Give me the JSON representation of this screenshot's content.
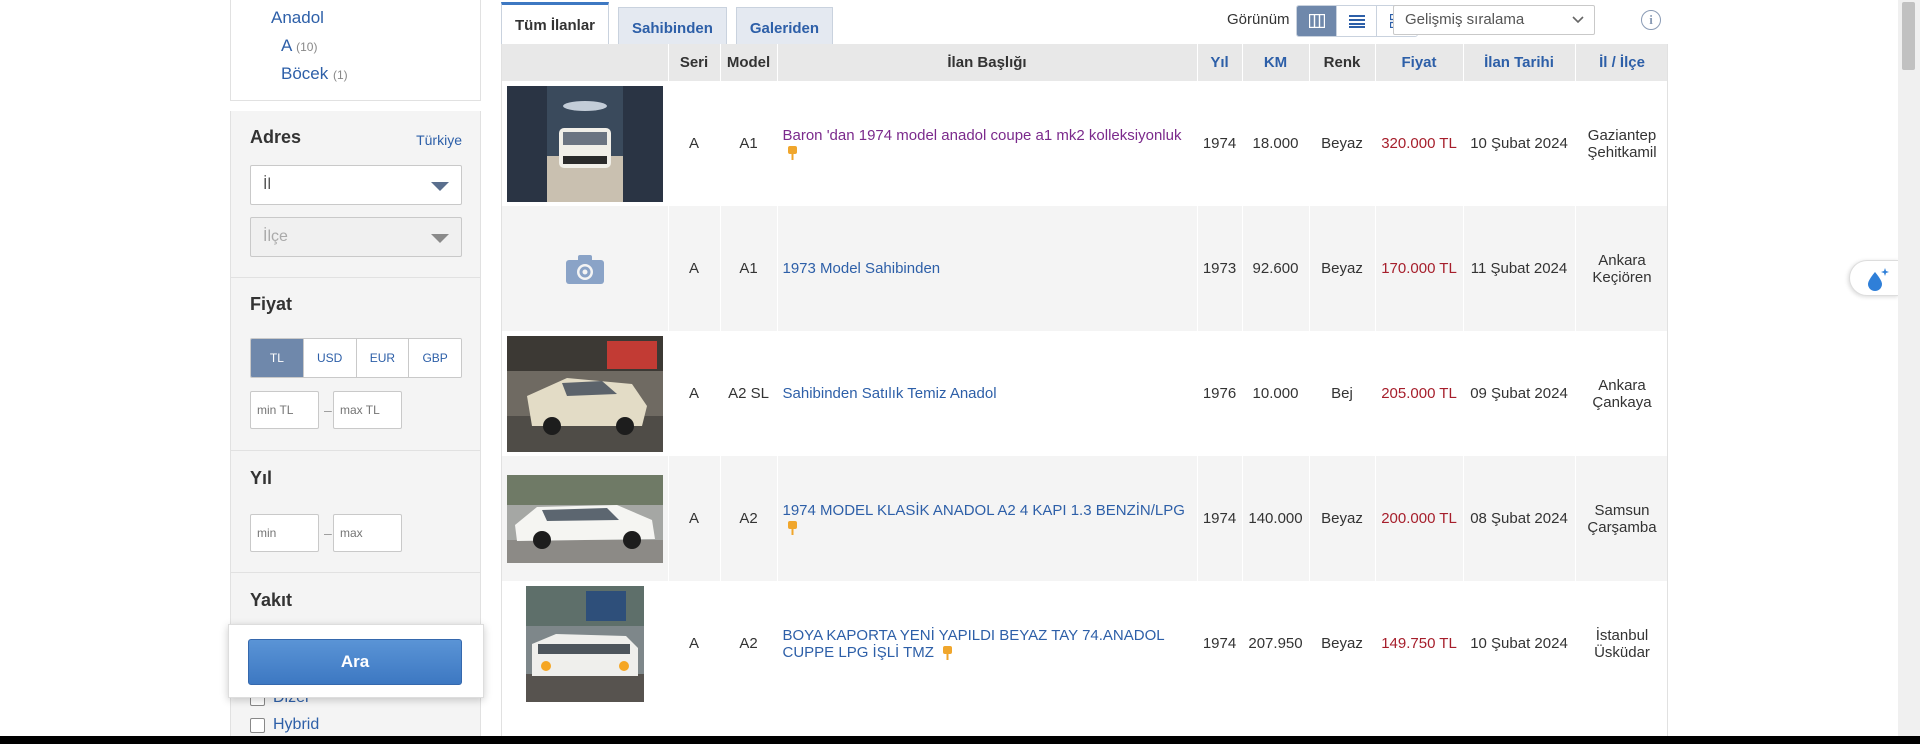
{
  "sidebar": {
    "categories": [
      {
        "label": "Anadol",
        "count": ""
      },
      {
        "label": "A",
        "count": "(10)"
      },
      {
        "label": "Böcek",
        "count": "(1)"
      }
    ],
    "address": {
      "title": "Adres",
      "country_link": "Türkiye",
      "city_placeholder": "İl",
      "district_placeholder": "İlçe"
    },
    "price": {
      "title": "Fiyat",
      "currencies": [
        "TL",
        "USD",
        "EUR",
        "GBP"
      ],
      "selected_currency": "TL",
      "min_placeholder": "min TL",
      "max_placeholder": "max TL",
      "separator": "–"
    },
    "year": {
      "title": "Yıl",
      "min_placeholder": "min",
      "max_placeholder": "max",
      "separator": "–"
    },
    "fuel": {
      "title": "Yakıt",
      "options": [
        "Dizel",
        "Hybrid"
      ]
    },
    "search_button": "Ara"
  },
  "tabs": [
    {
      "label": "Tüm İlanlar",
      "active": true
    },
    {
      "label": "Sahibinden",
      "active": false
    },
    {
      "label": "Galeriden",
      "active": false
    }
  ],
  "toolbar": {
    "view_label": "Görünüm",
    "view_modes": [
      "table-view-icon",
      "list-view-icon",
      "grid-view-icon"
    ],
    "active_view": "table-view-icon",
    "sort_value": "Gelişmiş sıralama",
    "info_label": "i"
  },
  "table": {
    "headers": [
      "",
      "Seri",
      "Model",
      "İlan Başlığı",
      "Yıl",
      "KM",
      "Renk",
      "Fiyat",
      "İlan Tarihi",
      "İl / İlçe"
    ],
    "rows": [
      {
        "series": "A",
        "model": "A1",
        "title": "Baron 'dan 1974 model anadol coupe a1 mk2 kolleksiyonluk",
        "year": "1974",
        "km": "18.000",
        "color": "Beyaz",
        "price": "320.000 TL",
        "date": "10 Şubat 2024",
        "city": "Gaziantep",
        "district": "Şehitkamil",
        "has_pin": true,
        "visited": true,
        "photo": "car-white-showroom"
      },
      {
        "series": "A",
        "model": "A1",
        "title": "1973 Model Sahibinden",
        "year": "1973",
        "km": "92.600",
        "color": "Beyaz",
        "price": "170.000 TL",
        "date": "11 Şubat 2024",
        "city": "Ankara",
        "district": "Keçiören",
        "has_pin": false,
        "visited": false,
        "photo": "no-photo"
      },
      {
        "series": "A",
        "model": "A2 SL",
        "title": "Sahibinden Satılık Temiz Anadol",
        "year": "1976",
        "km": "10.000",
        "color": "Bej",
        "price": "205.000 TL",
        "date": "09 Şubat 2024",
        "city": "Ankara",
        "district": "Çankaya",
        "has_pin": false,
        "visited": false,
        "photo": "car-beige-street"
      },
      {
        "series": "A",
        "model": "A2",
        "title": "1974 MODEL KLASİK ANADOL A2 4 KAPI 1.3 BENZİN/LPG",
        "year": "1974",
        "km": "140.000",
        "color": "Beyaz",
        "price": "200.000 TL",
        "date": "08 Şubat 2024",
        "city": "Samsun",
        "district": "Çarşamba",
        "has_pin": true,
        "visited": false,
        "photo": "car-white-side"
      },
      {
        "series": "A",
        "model": "A2",
        "title": "BOYA KAPORTA YENİ YAPILDI BEYAZ TAY 74.ANADOL CUPPE LPG İŞLİ TMZ",
        "year": "1974",
        "km": "207.950",
        "color": "Beyaz",
        "price": "149.750 TL",
        "date": "10 Şubat 2024",
        "city": "İstanbul",
        "district": "Üsküdar",
        "has_pin": true,
        "visited": false,
        "photo": "car-white-wall"
      }
    ]
  },
  "colors": {
    "link": "#2d5fa8",
    "visited": "#7b2a8c",
    "price": "#a61e2b",
    "accent": "#6f88ab"
  }
}
